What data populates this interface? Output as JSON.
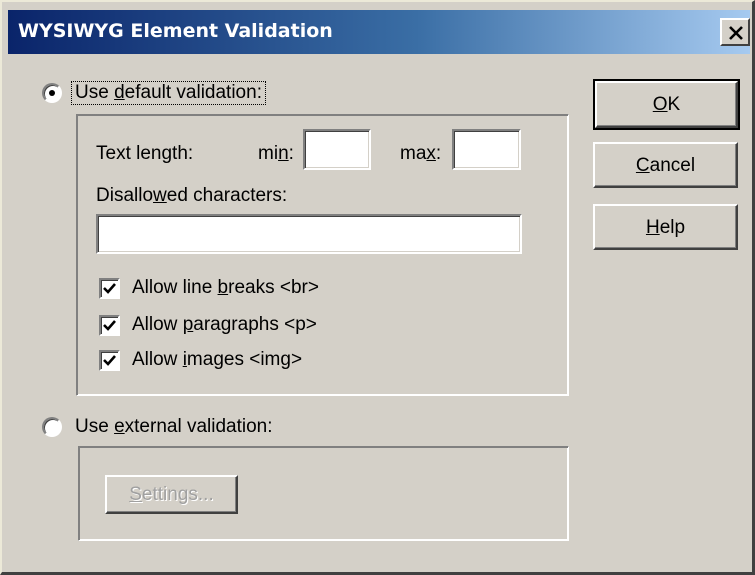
{
  "window": {
    "title": "WYSIWYG Element Validation"
  },
  "default_validation": {
    "label_pre": "Use ",
    "label_accel": "d",
    "label_post": "efault validation:",
    "selected": true,
    "text_length": {
      "label": "Text length:",
      "min_pre": "mi",
      "min_accel": "n",
      "min_post": ":",
      "min_value": "",
      "max_pre": "ma",
      "max_accel": "x",
      "max_post": ":",
      "max_value": ""
    },
    "disallowed": {
      "label_pre": "Disallo",
      "label_accel": "w",
      "label_post": "ed characters:",
      "value": ""
    },
    "options": [
      {
        "pre": "Allow line ",
        "accel": "b",
        "post": "reaks <br>",
        "checked": true
      },
      {
        "pre": "Allow ",
        "accel": "p",
        "post": "aragraphs <p>",
        "checked": true
      },
      {
        "pre": "Allow ",
        "accel": "i",
        "post": "mages <img>",
        "checked": true
      }
    ]
  },
  "external_validation": {
    "label_pre": "Use ",
    "label_accel": "e",
    "label_post": "xternal validation:",
    "selected": false,
    "settings_pre": "",
    "settings_accel": "S",
    "settings_post": "ettings..."
  },
  "buttons": {
    "ok": {
      "accel": "O",
      "post": "K"
    },
    "cancel": {
      "accel": "C",
      "post": "ancel"
    },
    "help": {
      "accel": "H",
      "post": "elp"
    }
  }
}
